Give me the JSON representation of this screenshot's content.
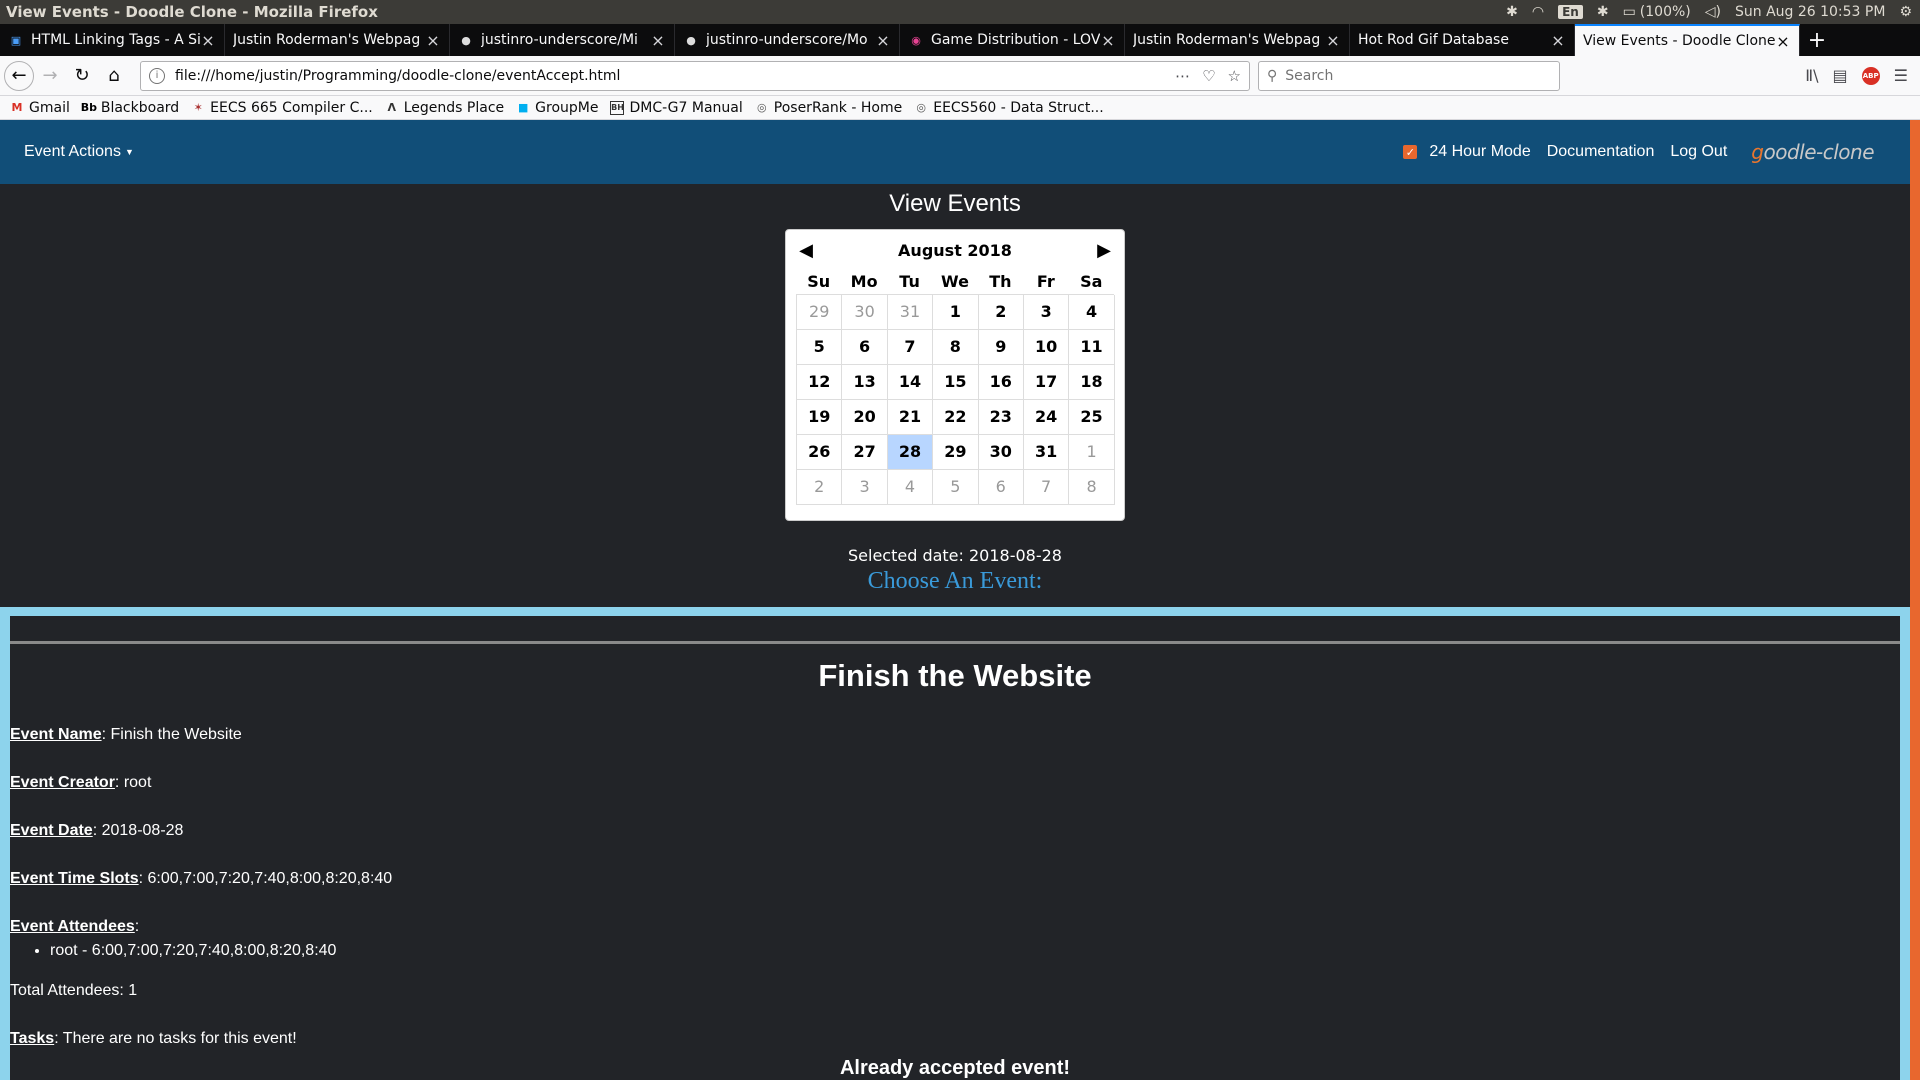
{
  "os": {
    "window_title": "View Events - Doodle Clone - Mozilla Firefox",
    "battery": "(100%)",
    "lang": "En",
    "clock": "Sun Aug 26 10:53 PM"
  },
  "tabs": [
    {
      "label": "HTML Linking Tags - A Si",
      "icon": "page-icon",
      "active": false
    },
    {
      "label": "Justin Roderman's Webpag",
      "icon": "none",
      "active": false
    },
    {
      "label": "justinro-underscore/Mi",
      "icon": "github-icon",
      "active": false
    },
    {
      "label": "justinro-underscore/Mo",
      "icon": "github-icon",
      "active": false
    },
    {
      "label": "Game Distribution - LOV",
      "icon": "gamedist-icon",
      "active": false
    },
    {
      "label": "Justin Roderman's Webpag",
      "icon": "none",
      "active": false
    },
    {
      "label": "Hot Rod Gif Database",
      "icon": "none",
      "active": false
    },
    {
      "label": "View Events - Doodle Clone",
      "icon": "none",
      "active": true
    }
  ],
  "navbar": {
    "url": "file:///home/justin/Programming/doodle-clone/eventAccept.html",
    "search_placeholder": "Search"
  },
  "bookmarks": [
    {
      "label": "Gmail",
      "icon": "gmail-icon"
    },
    {
      "label": "Blackboard",
      "icon": "blackboard-icon"
    },
    {
      "label": "EECS 665 Compiler C...",
      "icon": "compiler-icon"
    },
    {
      "label": "Legends Place",
      "icon": "legends-icon"
    },
    {
      "label": "GroupMe",
      "icon": "groupme-icon"
    },
    {
      "label": "DMC-G7 Manual",
      "icon": "bh-icon"
    },
    {
      "label": "PoserRank - Home",
      "icon": "globe-icon"
    },
    {
      "label": "EECS560 - Data Struct...",
      "icon": "globe-icon"
    }
  ],
  "header": {
    "event_actions": "Event Actions",
    "mode_label": "24 Hour Mode",
    "mode_checked": true,
    "docs": "Documentation",
    "logout": "Log Out",
    "brand_first": "g",
    "brand_rest": "oodle-clone"
  },
  "page": {
    "heading": "View Events",
    "selected_date": "Selected date: 2018-08-28",
    "choose": "Choose An Event:"
  },
  "calendar": {
    "month": "August 2018",
    "dow": [
      "Su",
      "Mo",
      "Tu",
      "We",
      "Th",
      "Fr",
      "Sa"
    ],
    "weeks": [
      [
        {
          "d": "29",
          "m": true
        },
        {
          "d": "30",
          "m": true
        },
        {
          "d": "31",
          "m": true
        },
        {
          "d": "1"
        },
        {
          "d": "2"
        },
        {
          "d": "3"
        },
        {
          "d": "4"
        }
      ],
      [
        {
          "d": "5"
        },
        {
          "d": "6"
        },
        {
          "d": "7"
        },
        {
          "d": "8"
        },
        {
          "d": "9"
        },
        {
          "d": "10"
        },
        {
          "d": "11"
        }
      ],
      [
        {
          "d": "12"
        },
        {
          "d": "13"
        },
        {
          "d": "14"
        },
        {
          "d": "15"
        },
        {
          "d": "16"
        },
        {
          "d": "17"
        },
        {
          "d": "18"
        }
      ],
      [
        {
          "d": "19"
        },
        {
          "d": "20"
        },
        {
          "d": "21"
        },
        {
          "d": "22"
        },
        {
          "d": "23"
        },
        {
          "d": "24"
        },
        {
          "d": "25"
        }
      ],
      [
        {
          "d": "26"
        },
        {
          "d": "27"
        },
        {
          "d": "28",
          "sel": true
        },
        {
          "d": "29"
        },
        {
          "d": "30"
        },
        {
          "d": "31"
        },
        {
          "d": "1",
          "m": true
        }
      ],
      [
        {
          "d": "2",
          "m": true
        },
        {
          "d": "3",
          "m": true
        },
        {
          "d": "4",
          "m": true
        },
        {
          "d": "5",
          "m": true
        },
        {
          "d": "6",
          "m": true
        },
        {
          "d": "7",
          "m": true
        },
        {
          "d": "8",
          "m": true
        }
      ]
    ]
  },
  "event": {
    "title": "Finish the Website",
    "name_key": "Event Name",
    "name_val": ": Finish the Website",
    "creator_key": "Event Creator",
    "creator_val": ": root",
    "date_key": "Event Date",
    "date_val": ": 2018-08-28",
    "slots_key": "Event Time Slots",
    "slots_val": ": 6:00,7:00,7:20,7:40,8:00,8:20,8:40",
    "attendees_key": "Event Attendees",
    "attendees_val": ":",
    "attendees": [
      "root - 6:00,7:00,7:20,7:40,8:00,8:20,8:40"
    ],
    "total": "Total Attendees: 1",
    "tasks_key": "Tasks",
    "tasks_val": ": There are no tasks for this event!",
    "accepted": "Already accepted event!"
  }
}
